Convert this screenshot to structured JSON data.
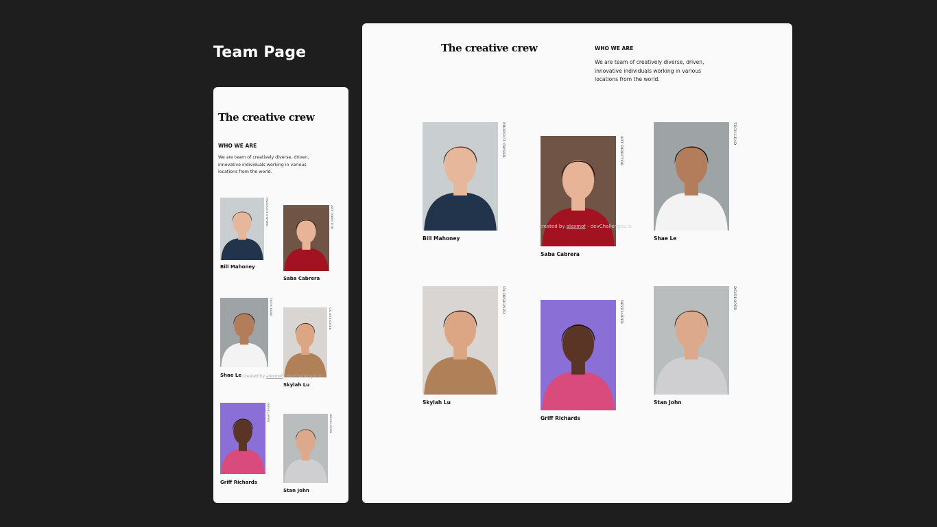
{
  "page": {
    "heading": "Team Page"
  },
  "section": {
    "title": "The creative crew",
    "eyebrow": "WHO WE ARE",
    "description": "We are team of creatively diverse, driven, innovative individuals working in various locations from the world."
  },
  "credit": {
    "prefix": "created by",
    "author": "alexmof",
    "suffix": "- devChallenges.io"
  },
  "members": [
    {
      "name": "Bill Mahoney",
      "role": "PRODUCT OWNER",
      "colors": {
        "bg": "#c9ced1",
        "skin": "#e7b79b",
        "hair": "#4a3324",
        "shirt": "#22344b"
      }
    },
    {
      "name": "Saba Cabrera",
      "role": "ART DIRECTOR",
      "colors": {
        "bg": "#705547",
        "skin": "#e8b497",
        "hair": "#2a1812",
        "shirt": "#a31220"
      }
    },
    {
      "name": "Shae Le",
      "role": "TECH LEAD",
      "colors": {
        "bg": "#9ea3a6",
        "skin": "#b37c5a",
        "hair": "#1a120e",
        "shirt": "#f3f3f3"
      }
    },
    {
      "name": "Skylah Lu",
      "role": "UX DESIGNER",
      "colors": {
        "bg": "#d8d5d2",
        "skin": "#dca584",
        "hair": "#2e1d15",
        "shirt": "#b08159"
      }
    },
    {
      "name": "Griff Richards",
      "role": "DEVELOPER",
      "colors": {
        "bg": "#8a6fd6",
        "skin": "#5a3424",
        "hair": "#17100c",
        "shirt": "#d94b7c"
      }
    },
    {
      "name": "Stan John",
      "role": "DEVELOPER",
      "colors": {
        "bg": "#b9bdbd",
        "skin": "#dca98c",
        "hair": "#4a2f1f",
        "shirt": "#cfcfd1"
      }
    }
  ]
}
